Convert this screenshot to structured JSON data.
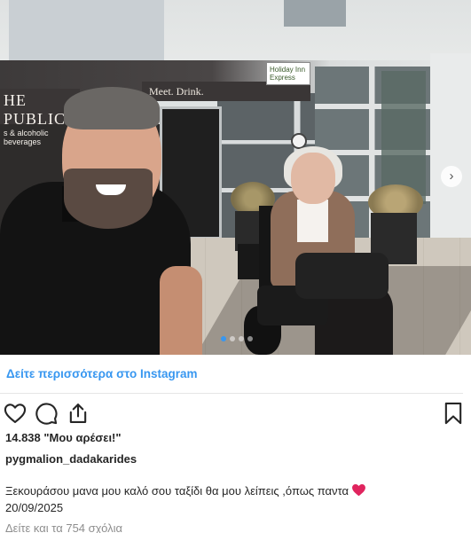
{
  "photo": {
    "sign_public": "HE PUBLIC",
    "sign_public_sub": "s & alcoholic beverages",
    "sign_meet": "Meet. Drink.",
    "hotel_logo": "Holiday Inn Express",
    "carousel_next_glyph": "›",
    "carousel_dots": 4,
    "carousel_active_index": 0
  },
  "more_link": "Δείτε περισσότερα στο Instagram",
  "actions": {
    "icons": [
      "heart-icon",
      "comment-icon",
      "share-icon",
      "bookmark-icon"
    ]
  },
  "likes": "14.838 \"Μου αρέσει!\"",
  "username": "pygmalion_dadakarides",
  "caption": "Ξεκουράσου μανα μου καλό σου ταξίδι θα μου λείπεις ,όπως παντα",
  "date": "20/09/2025",
  "comments_link": "Δείτε και τα 754 σχόλια",
  "colors": {
    "link_blue": "#3897f0",
    "text": "#262626",
    "muted": "#8e8e8e",
    "heart_red": "#e0245e"
  }
}
